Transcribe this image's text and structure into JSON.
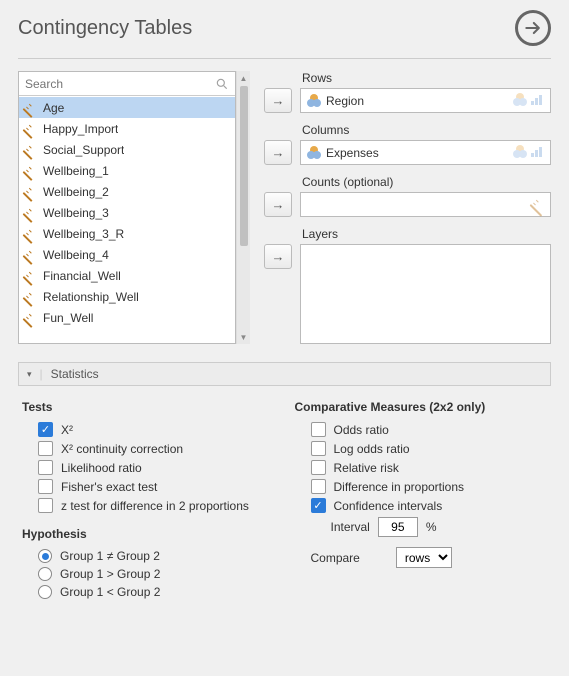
{
  "title": "Contingency Tables",
  "search_placeholder": "Search",
  "variables": [
    {
      "name": "Age",
      "selected": true
    },
    {
      "name": "Happy_Import"
    },
    {
      "name": "Social_Support"
    },
    {
      "name": "Wellbeing_1"
    },
    {
      "name": "Wellbeing_2"
    },
    {
      "name": "Wellbeing_3"
    },
    {
      "name": "Wellbeing_3_R"
    },
    {
      "name": "Wellbeing_4"
    },
    {
      "name": "Financial_Well"
    },
    {
      "name": "Relationship_Well"
    },
    {
      "name": "Fun_Well"
    }
  ],
  "fields": {
    "rows_label": "Rows",
    "rows_var": "Region",
    "columns_label": "Columns",
    "columns_var": "Expenses",
    "counts_label": "Counts (optional)",
    "layers_label": "Layers"
  },
  "panel": {
    "title": "Statistics"
  },
  "tests": {
    "heading": "Tests",
    "chi2": {
      "label": "X²",
      "checked": true
    },
    "chi2cc": {
      "label": "X² continuity correction",
      "checked": false
    },
    "likelihood": {
      "label": "Likelihood ratio",
      "checked": false
    },
    "fisher": {
      "label": "Fisher's exact test",
      "checked": false
    },
    "ztest": {
      "label": "z test for difference in 2 proportions",
      "checked": false
    }
  },
  "hypothesis": {
    "heading": "Hypothesis",
    "neq": {
      "label": "Group 1 ≠ Group 2",
      "checked": true
    },
    "gt": {
      "label": "Group 1 > Group 2",
      "checked": false
    },
    "lt": {
      "label": "Group 1 < Group 2",
      "checked": false
    }
  },
  "comparative": {
    "heading": "Comparative Measures (2x2 only)",
    "odds": {
      "label": "Odds ratio",
      "checked": false
    },
    "logodds": {
      "label": "Log odds ratio",
      "checked": false
    },
    "relrisk": {
      "label": "Relative risk",
      "checked": false
    },
    "diffprop": {
      "label": "Difference in proportions",
      "checked": false
    },
    "ci": {
      "label": "Confidence intervals",
      "checked": true
    },
    "interval_label": "Interval",
    "interval_value": "95",
    "interval_suffix": "%",
    "compare_label": "Compare",
    "compare_value": "rows"
  }
}
